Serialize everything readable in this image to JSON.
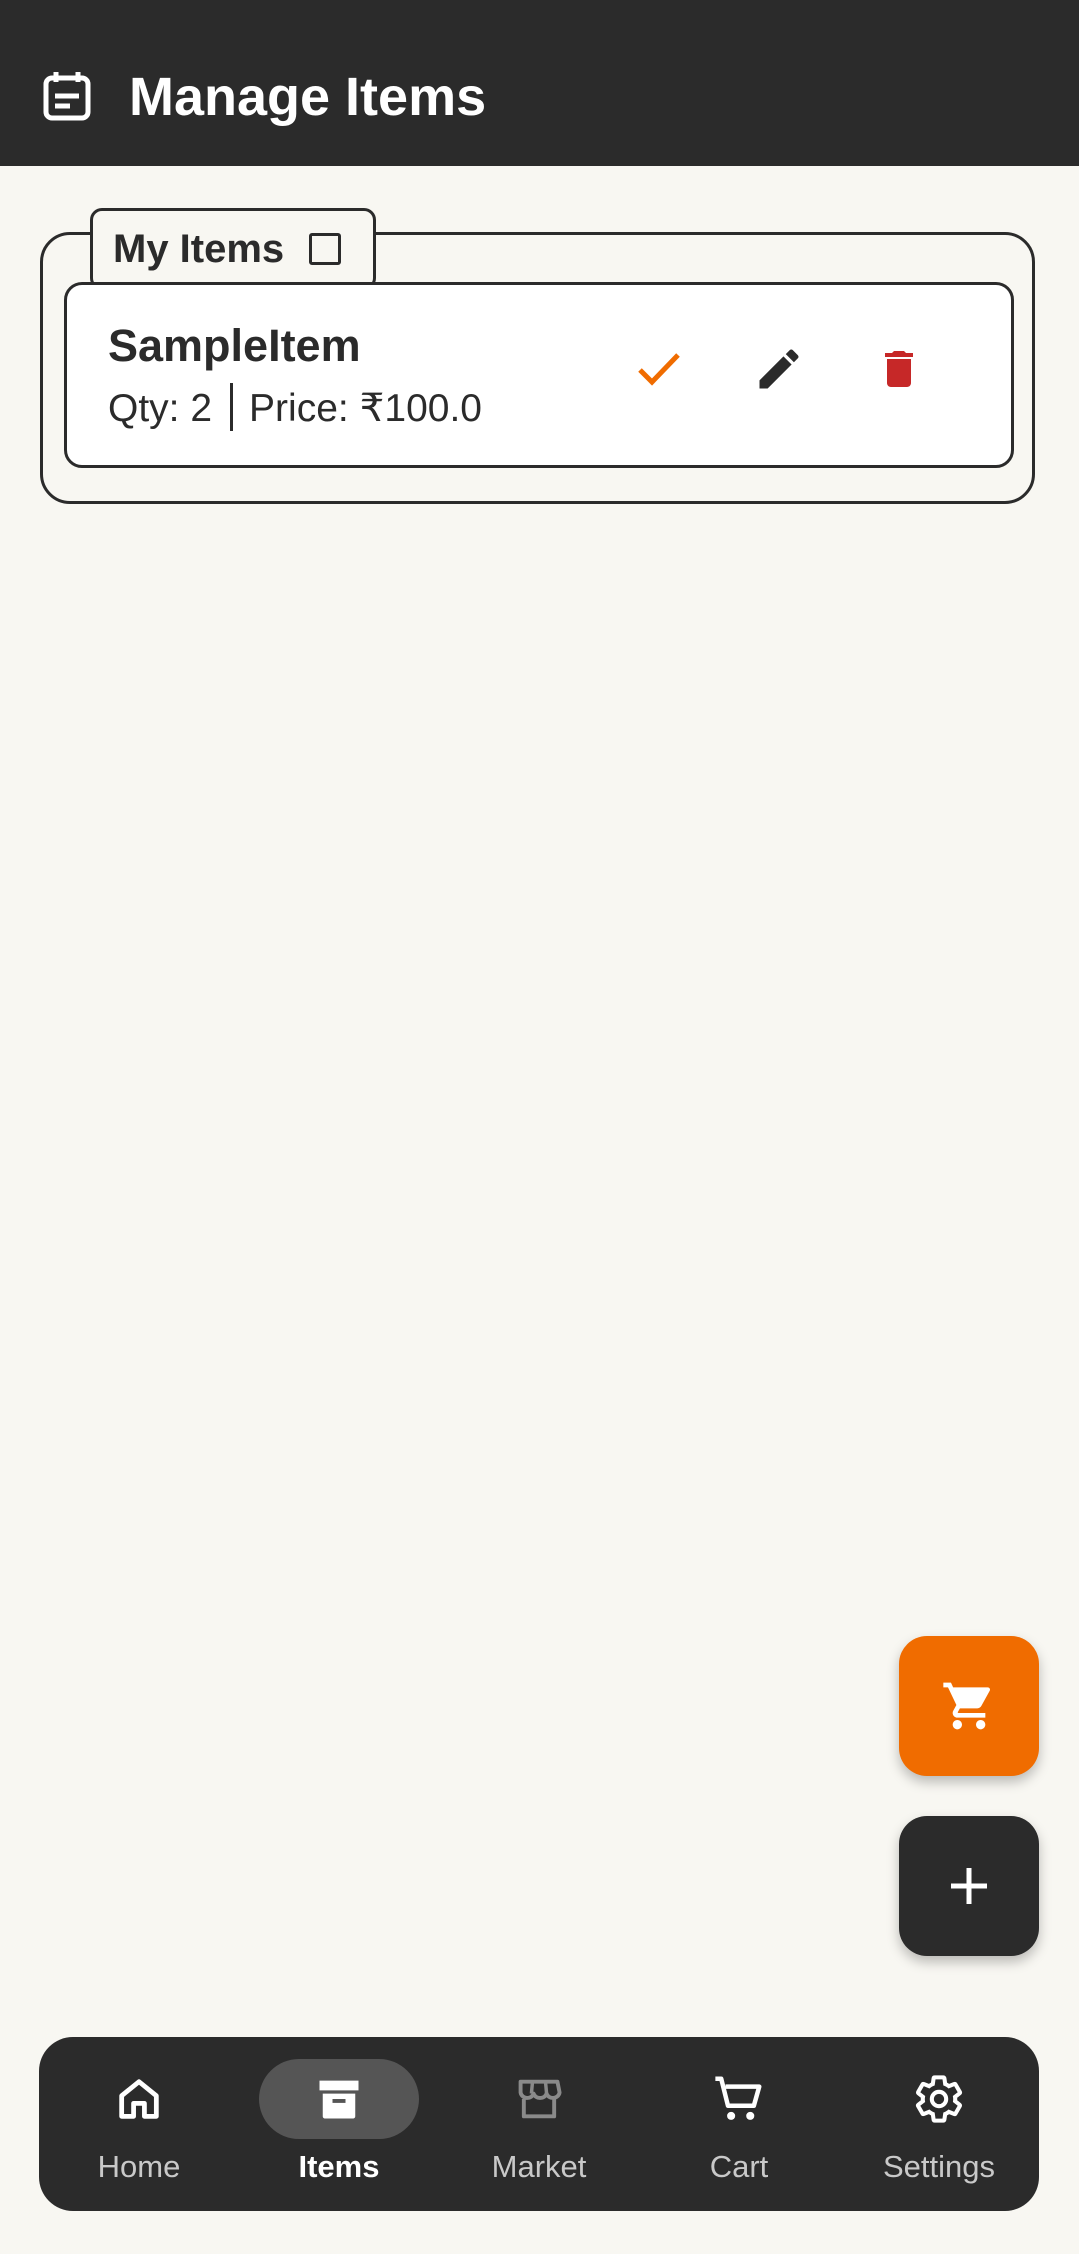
{
  "appbar": {
    "title": "Manage Items",
    "icon": "calendar-icon"
  },
  "group": {
    "label": "My Items",
    "checked": false
  },
  "items": [
    {
      "name": "SampleItem",
      "qty_label": "Qty: 2",
      "price_label": "Price: ₹100.0"
    }
  ],
  "colors": {
    "accent": "#f06c00",
    "dark": "#2b2b2b",
    "danger": "#c62828",
    "background": "#f8f7f2"
  },
  "nav": {
    "items": [
      {
        "label": "Home",
        "icon": "home-icon"
      },
      {
        "label": "Items",
        "icon": "archive-icon",
        "active": true
      },
      {
        "label": "Market",
        "icon": "storefront-icon"
      },
      {
        "label": "Cart",
        "icon": "cart-icon"
      },
      {
        "label": "Settings",
        "icon": "gear-icon"
      }
    ]
  }
}
